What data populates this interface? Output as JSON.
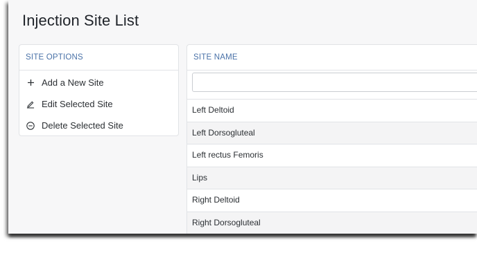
{
  "page": {
    "title": "Injection Site List"
  },
  "site_options": {
    "header": "SITE OPTIONS",
    "items": [
      {
        "label": "Add a New Site",
        "icon": "plus-icon"
      },
      {
        "label": "Edit Selected Site",
        "icon": "pencil-icon"
      },
      {
        "label": "Delete Selected Site",
        "icon": "circle-minus-icon"
      }
    ]
  },
  "sites_table": {
    "header": "SITE NAME",
    "filter": {
      "value": "",
      "placeholder": ""
    },
    "rows": [
      "Left Deltoid",
      "Left Dorsogluteal",
      "Left rectus Femoris",
      "Lips",
      "Right Deltoid",
      "Right Dorsogluteal"
    ]
  },
  "colors": {
    "header_text": "#4a72a8",
    "body_text": "#2b2f33",
    "background": "#f7f7f8",
    "row_alt": "#f4f4f5",
    "border": "#e1e3e6"
  }
}
